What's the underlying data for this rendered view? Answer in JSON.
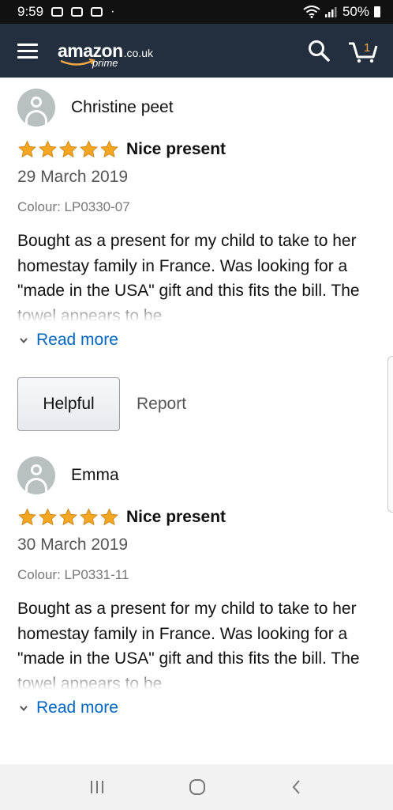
{
  "status_bar": {
    "time": "9:59",
    "battery": "50%"
  },
  "app_bar": {
    "logo_text": "amazon",
    "logo_tld": ".co.uk",
    "logo_sub": "prime",
    "cart_count": "1"
  },
  "reviews": [
    {
      "name": "Christine peet",
      "stars": 5,
      "title": "Nice present",
      "date": "29 March 2019",
      "colour": "Colour: LP0330-07",
      "body": "Bought as a present for my child to take to her homestay family in France. Was looking for a \"made in the USA\" gift and this fits the bill. The towel appears to be",
      "read_more": "Read more",
      "helpful": "Helpful",
      "report": "Report"
    },
    {
      "name": "Emma",
      "stars": 5,
      "title": "Nice present",
      "date": "30 March 2019",
      "colour": "Colour: LP0331-11",
      "body": "Bought as a present for my child to take to her homestay family in France. Was looking for a \"made in the USA\" gift and this fits the bill. The towel appears to be",
      "read_more": "Read more"
    }
  ],
  "colors": {
    "app_bar": "#232f3e",
    "link": "#0066c0",
    "star": "#f5a623",
    "cart_accent": "#f3a847"
  }
}
